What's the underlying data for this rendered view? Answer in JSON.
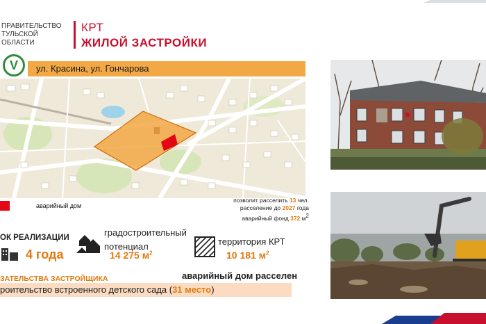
{
  "header": {
    "government": [
      "ПРАВИТЕЛЬСТВО",
      "ТУЛЬСКОЙ",
      "ОБЛАСТИ"
    ],
    "title_line1": "КРТ",
    "title_line2": "ЖИЛОЙ ЗАСТРОЙКИ"
  },
  "location": {
    "badge": "V",
    "address": "ул. Красина, ул. Гончарова"
  },
  "legend": {
    "emergency_house": "аварийный дом"
  },
  "resettlement": {
    "line1_prefix": "позволит расселить",
    "people": "13",
    "line1_suffix": "чел.",
    "line2_prefix": "расселение до",
    "year": "2027",
    "line2_suffix": "года",
    "line3_prefix": "аварийный фонд",
    "area": "372",
    "line3_suffix": "м"
  },
  "stats": {
    "term_label": "ОК РЕАЛИЗАЦИИ",
    "term_value": "4 года",
    "potential_label_line1": "градостроительный",
    "potential_label_line2": "потенциал",
    "potential_value": "14 275 м",
    "territory_label": "территория КРТ",
    "territory_value": "10 181 м"
  },
  "obligations": {
    "title": "ЗАТЕЛЬСТВА ЗАСТРОЙЩИКА",
    "resettled": "аварийный дом расселен",
    "kindergarten_prefix": "роительство встроенного детского сада (",
    "places": "31 место",
    "kindergarten_suffix": ")"
  },
  "colors": {
    "accent_red": "#c8102e",
    "accent_orange": "#e07a10",
    "strip_orange": "#f2a844",
    "badge_green": "#2f8b3a"
  },
  "icons": [
    "check-v-icon",
    "houses-icon",
    "hatched-area-icon"
  ]
}
